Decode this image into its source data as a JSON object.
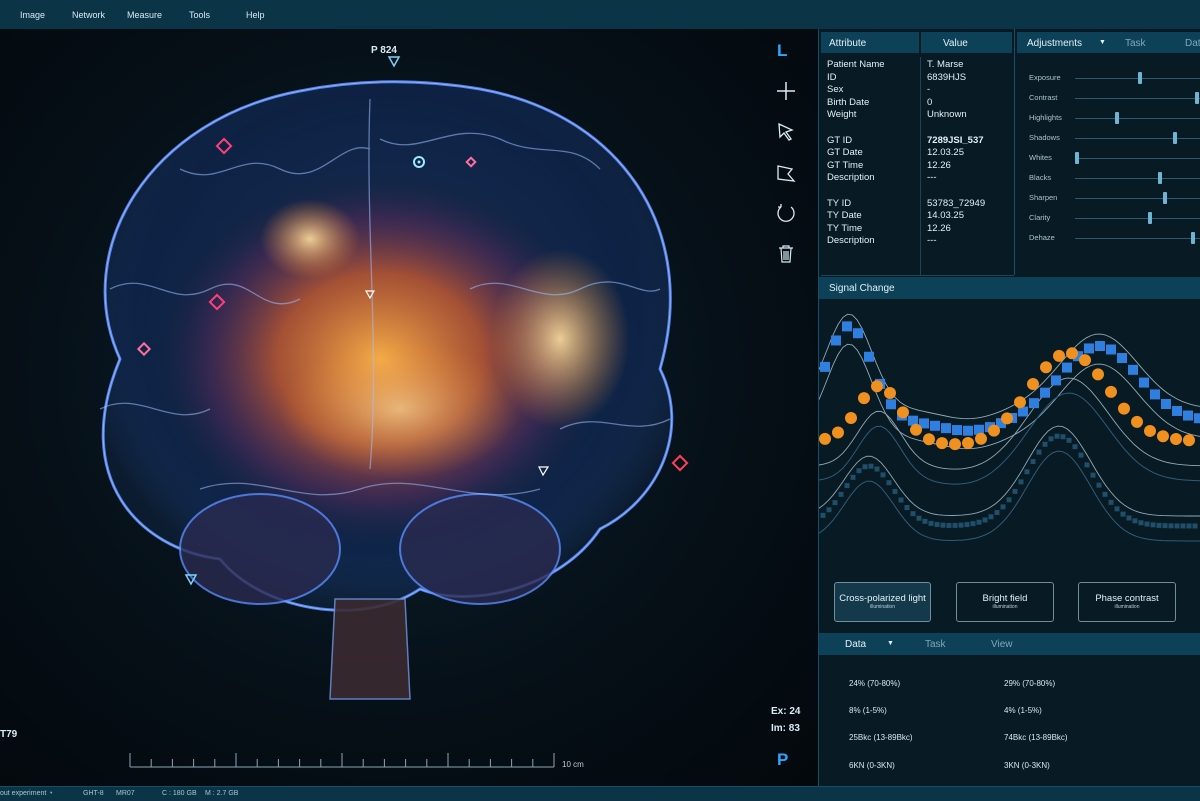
{
  "menu": [
    "Image",
    "Network",
    "Measure",
    "Tools",
    "Help"
  ],
  "viewer": {
    "top_label": "P 824",
    "left_label": "T79",
    "orientation_top": "L",
    "orientation_bottom": "P",
    "ex_label": "Ex: 24",
    "im_label": "Im: 83",
    "scale_label": "10 cm"
  },
  "tools": [
    "add-tool",
    "pointer-tool",
    "polygon-tool",
    "rotate-tool",
    "delete-tool"
  ],
  "attributes": {
    "header_attr": "Attribute",
    "header_value": "Value",
    "rows": [
      {
        "k": "Patient Name",
        "v": "T. Marse"
      },
      {
        "k": "ID",
        "v": "6839HJS"
      },
      {
        "k": "Sex",
        "v": "-"
      },
      {
        "k": "Birth Date",
        "v": "0"
      },
      {
        "k": "Weight",
        "v": "Unknown"
      },
      {
        "k": "",
        "v": ""
      },
      {
        "k": "GT ID",
        "v": "7289JSI_537"
      },
      {
        "k": "GT Date",
        "v": "12.03.25"
      },
      {
        "k": "GT Time",
        "v": "12.26"
      },
      {
        "k": "Description",
        "v": "---"
      },
      {
        "k": "",
        "v": ""
      },
      {
        "k": "TY ID",
        "v": "53783_72949"
      },
      {
        "k": "TY Date",
        "v": "14.03.25"
      },
      {
        "k": "TY Time",
        "v": "12.26"
      },
      {
        "k": "Description",
        "v": "---"
      }
    ]
  },
  "adjustments": {
    "tab_active": "Adjustments",
    "tab_task": "Task",
    "tab_data": "Data",
    "sliders": [
      {
        "label": "Exposure",
        "value": 0.52
      },
      {
        "label": "Contrast",
        "value": 0.98
      },
      {
        "label": "Highlights",
        "value": 0.33
      },
      {
        "label": "Shadows",
        "value": 0.8
      },
      {
        "label": "Whites",
        "value": 0.0
      },
      {
        "label": "Blacks",
        "value": 0.68
      },
      {
        "label": "Sharpen",
        "value": 0.72
      },
      {
        "label": "Clarity",
        "value": 0.6
      },
      {
        "label": "Dehaze",
        "value": 0.95
      }
    ]
  },
  "signal": {
    "title": "Signal Change",
    "illumination": [
      {
        "title": "Cross-polarized light",
        "sub": "illumination"
      },
      {
        "title": "Bright field",
        "sub": "illumination"
      },
      {
        "title": "Phase contrast",
        "sub": "illumination"
      }
    ]
  },
  "data_panel": {
    "tab_data": "Data",
    "tab_task": "Task",
    "tab_view": "View",
    "cells": [
      [
        "24% (70-80%)",
        "29% (70-80%)"
      ],
      [
        "8% (1-5%)",
        "4% (1-5%)"
      ],
      [
        "25Bkc (13-89Bkc)",
        "74Bkc (13-89Bkc)"
      ],
      [
        "6KN (0-3KN)",
        "3KN (0-3KN)"
      ]
    ]
  },
  "status": [
    "out experiment",
    "GHT-8",
    "MR07",
    "C : 180 GB",
    "M : 2.7 GB"
  ],
  "colors": {
    "accent": "#2aa7ff",
    "orange": "#f0901f",
    "square": "#2f7fe0",
    "panel": "#0d4158"
  }
}
